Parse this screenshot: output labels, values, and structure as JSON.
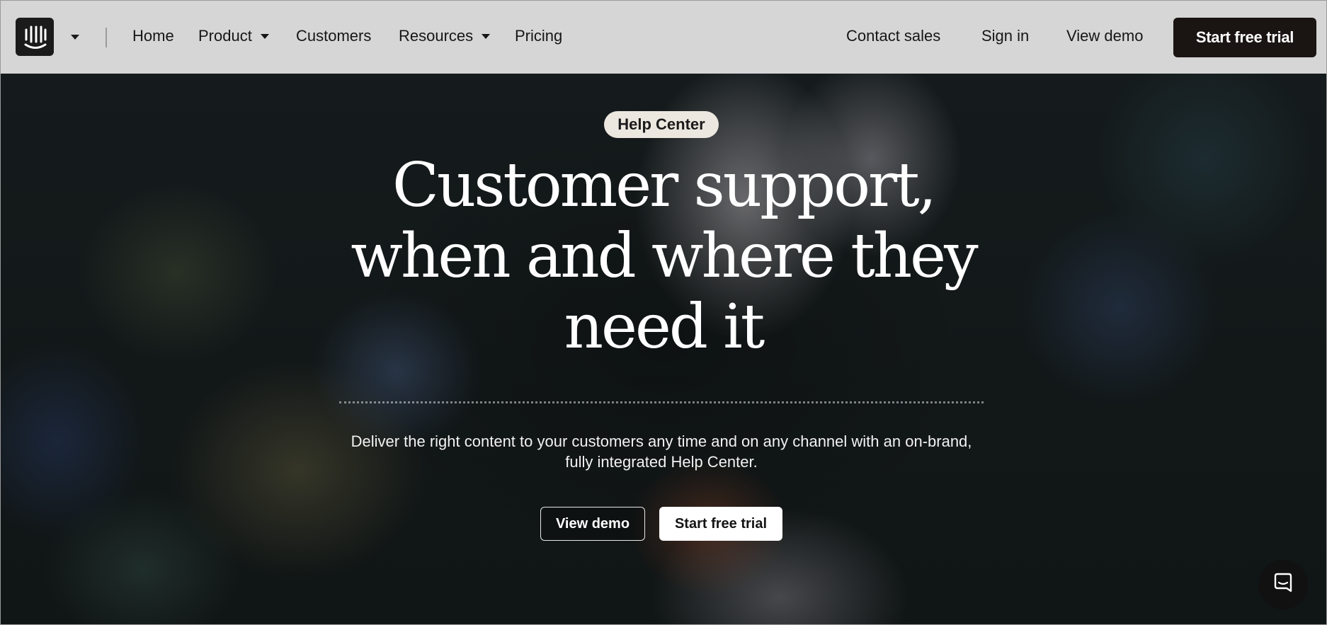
{
  "nav": {
    "logo_icon": "intercom-logo-icon",
    "links": {
      "home": "Home",
      "product": "Product",
      "customers": "Customers",
      "resources": "Resources",
      "pricing": "Pricing"
    },
    "right": {
      "contact_sales": "Contact sales",
      "sign_in": "Sign in",
      "view_demo": "View demo",
      "start_trial": "Start free trial"
    }
  },
  "hero": {
    "badge": "Help Center",
    "headline": "Customer support, when and where they need it",
    "subtitle": "Deliver the right content to your customers any time and on any channel with an on-brand, fully integrated Help Center.",
    "buttons": {
      "view_demo": "View demo",
      "start_trial": "Start free trial"
    }
  },
  "chat": {
    "icon": "chat-bubble-icon"
  },
  "colors": {
    "nav_bg": "#d6d6d6",
    "primary_button": "#1a1412",
    "badge_bg": "#ece8e0"
  }
}
